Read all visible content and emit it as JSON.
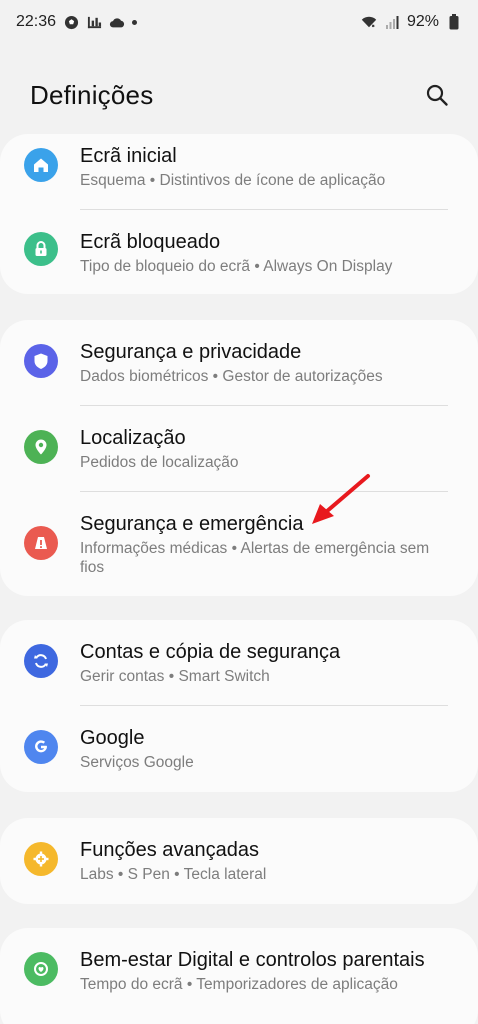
{
  "status_bar": {
    "time": "22:36",
    "battery": "92%",
    "icons_left": [
      "soccer-ball-icon",
      "bar-chart-icon",
      "cloud-icon",
      "dot-icon"
    ],
    "icons_right": [
      "wifi-icon",
      "signal-icon",
      "battery-icon"
    ]
  },
  "header": {
    "title": "Definições",
    "search_icon": "search-icon"
  },
  "groups": [
    {
      "items": [
        {
          "title": "Ecrã inicial",
          "subtitle": "Esquema  •  Distintivos de ícone de aplicação",
          "icon": "home-icon",
          "color": "#3aa2ea"
        },
        {
          "title": "Ecrã bloqueado",
          "subtitle": "Tipo de bloqueio do ecrã  •  Always On Display",
          "icon": "lock-icon",
          "color": "#3cbf8a"
        }
      ]
    },
    {
      "items": [
        {
          "title": "Segurança e privacidade",
          "subtitle": "Dados biométricos  •  Gestor de autorizações",
          "icon": "shield-icon",
          "color": "#5b63e8"
        },
        {
          "title": "Localização",
          "subtitle": "Pedidos de localização",
          "icon": "location-icon",
          "color": "#4db255"
        },
        {
          "title": "Segurança e emergência",
          "subtitle": "Informações médicas  •  Alertas de emergência sem fios",
          "icon": "warning-icon",
          "color": "#ea5a50"
        }
      ]
    },
    {
      "items": [
        {
          "title": "Contas e cópia de segurança",
          "subtitle": "Gerir contas  •  Smart Switch",
          "icon": "sync-icon",
          "color": "#3e68e0"
        },
        {
          "title": "Google",
          "subtitle": "Serviços Google",
          "icon": "google-icon",
          "color": "#4f86ef"
        }
      ]
    },
    {
      "items": [
        {
          "title": "Funções avançadas",
          "subtitle": "Labs  •  S Pen  •  Tecla lateral",
          "icon": "gear-plus-icon",
          "color": "#f5b82c"
        }
      ]
    },
    {
      "items": [
        {
          "title": "Bem-estar Digital e controlos parentais",
          "subtitle": "Tempo do ecrã  •  Temporizadores de aplicação",
          "icon": "wellbeing-icon",
          "color": "#4cbb62"
        }
      ]
    }
  ],
  "annotation": {
    "arrow_color": "#e8191e",
    "arrow_icon": "red-arrow-icon"
  }
}
